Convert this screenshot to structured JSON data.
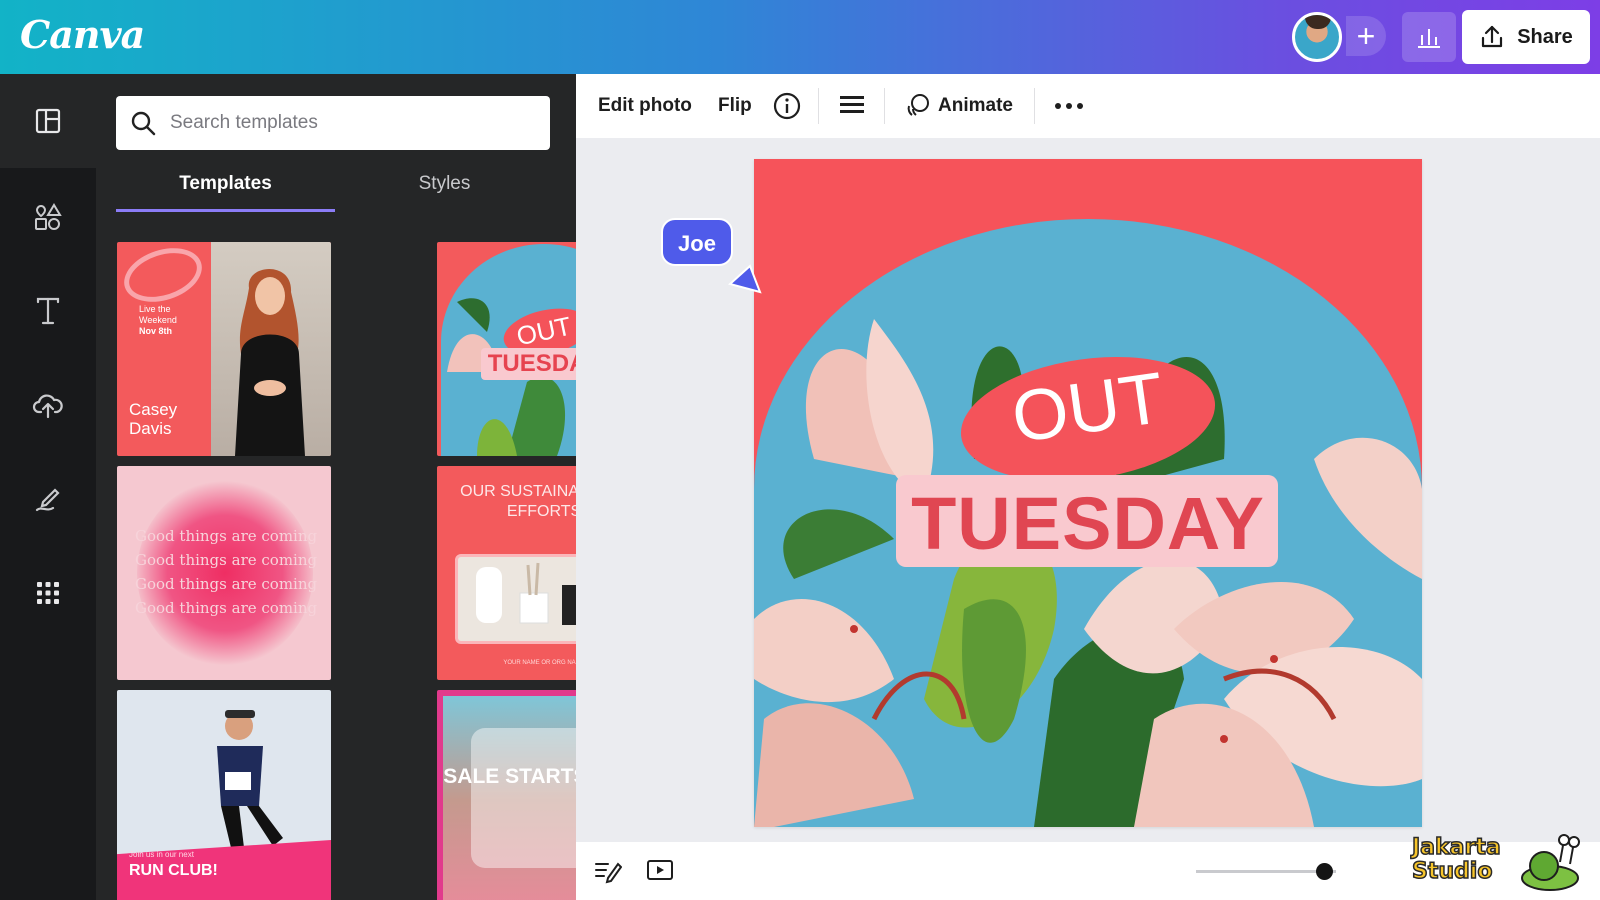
{
  "app": {
    "logo": "Canva"
  },
  "header": {
    "share_label": "Share",
    "add_collaborator": "+"
  },
  "sidebar": {
    "items": [
      {
        "icon": "layout-icon",
        "name": "Design"
      },
      {
        "icon": "elements-icon",
        "name": "Elements"
      },
      {
        "icon": "text-icon",
        "name": "Text"
      },
      {
        "icon": "upload-cloud-icon",
        "name": "Uploads"
      },
      {
        "icon": "draw-icon",
        "name": "Draw"
      },
      {
        "icon": "apps-grid-icon",
        "name": "Apps"
      }
    ]
  },
  "panel": {
    "search_placeholder": "Search templates",
    "tabs": [
      {
        "label": "Templates",
        "active": true
      },
      {
        "label": "Styles",
        "active": false
      }
    ],
    "templates": [
      {
        "lines": [
          "Live the",
          "Weekend",
          "Nov 8th"
        ],
        "name": "Casey Davis"
      },
      {
        "top": "OUT",
        "bottom": "TUESDAY"
      },
      {
        "lines": [
          "Good things are coming",
          "Good things are coming",
          "Good things are coming",
          "Good things are coming"
        ]
      },
      {
        "title": "OUR SUSTAINABILITY EFFORTS",
        "footer": "YOUR NAME OR ORG NAME"
      },
      {
        "small": "Join us in our next",
        "label": "RUN CLUB!"
      },
      {
        "text": "SALE STARTS NOW"
      }
    ]
  },
  "toolbar": {
    "edit_photo": "Edit photo",
    "flip": "Flip",
    "animate": "Animate"
  },
  "canvas": {
    "top_text": "OUT",
    "bottom_text": "TUESDAY",
    "collaborator": "Joe",
    "colors": {
      "background": "#f6535a",
      "arch": "#5ab1d1",
      "pill": "#f4535a",
      "label_bg": "#f9c9cf"
    }
  },
  "watermark": {
    "line1": "Jakarta",
    "line2": "Studio"
  },
  "colors": {
    "accent": "#8b7cf6",
    "collaborator": "#4f5bea"
  }
}
